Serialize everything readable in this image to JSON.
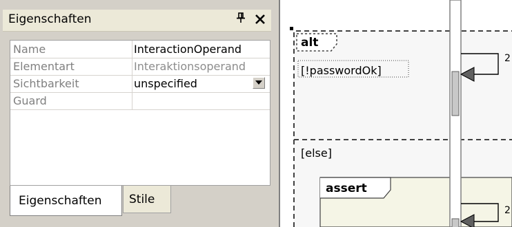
{
  "panel": {
    "title": "Eigenschaften",
    "pin_icon": "pin-icon",
    "close_icon": "close-icon",
    "rows": [
      {
        "name": "Name",
        "value": "InteractionOperand"
      },
      {
        "name": "Elementart",
        "value": "Interaktionsoperand"
      },
      {
        "name": "Sichtbarkeit",
        "value": "unspecified"
      },
      {
        "name": "Guard",
        "value": ""
      }
    ],
    "tabs": [
      {
        "label": "Eigenschaften",
        "active": true
      },
      {
        "label": "Stile",
        "active": false
      }
    ]
  },
  "diagram": {
    "fragment_operator": "alt",
    "guard": "[!passwordOk]",
    "else_guard": "[else]",
    "inner_fragment_operator": "assert",
    "message_number_top": "2",
    "message_number_bottom": "2"
  },
  "colors": {
    "panel_bg": "#d4d0c8",
    "header_bg": "#ece9d8",
    "assert_fill": "#f5f5e6",
    "alt_fill": "#f7f7f7",
    "activation_fill": "#c8c8c8"
  }
}
